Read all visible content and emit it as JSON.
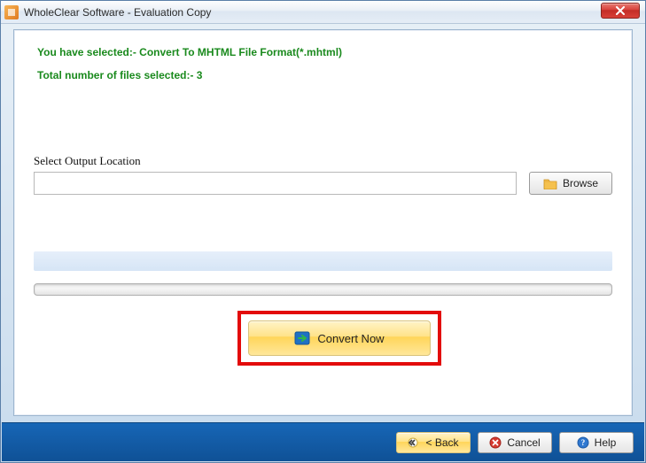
{
  "window": {
    "title": "WholeClear Software - Evaluation Copy"
  },
  "info": {
    "selection": "You have selected:- Convert To MHTML File Format(*.mhtml)",
    "count": "Total number of files selected:- 3"
  },
  "output": {
    "label": "Select Output Location",
    "value": "",
    "browse_label": "Browse"
  },
  "actions": {
    "convert_label": "Convert Now"
  },
  "footer": {
    "back_label": "< Back",
    "cancel_label": "Cancel",
    "help_label": "Help"
  }
}
